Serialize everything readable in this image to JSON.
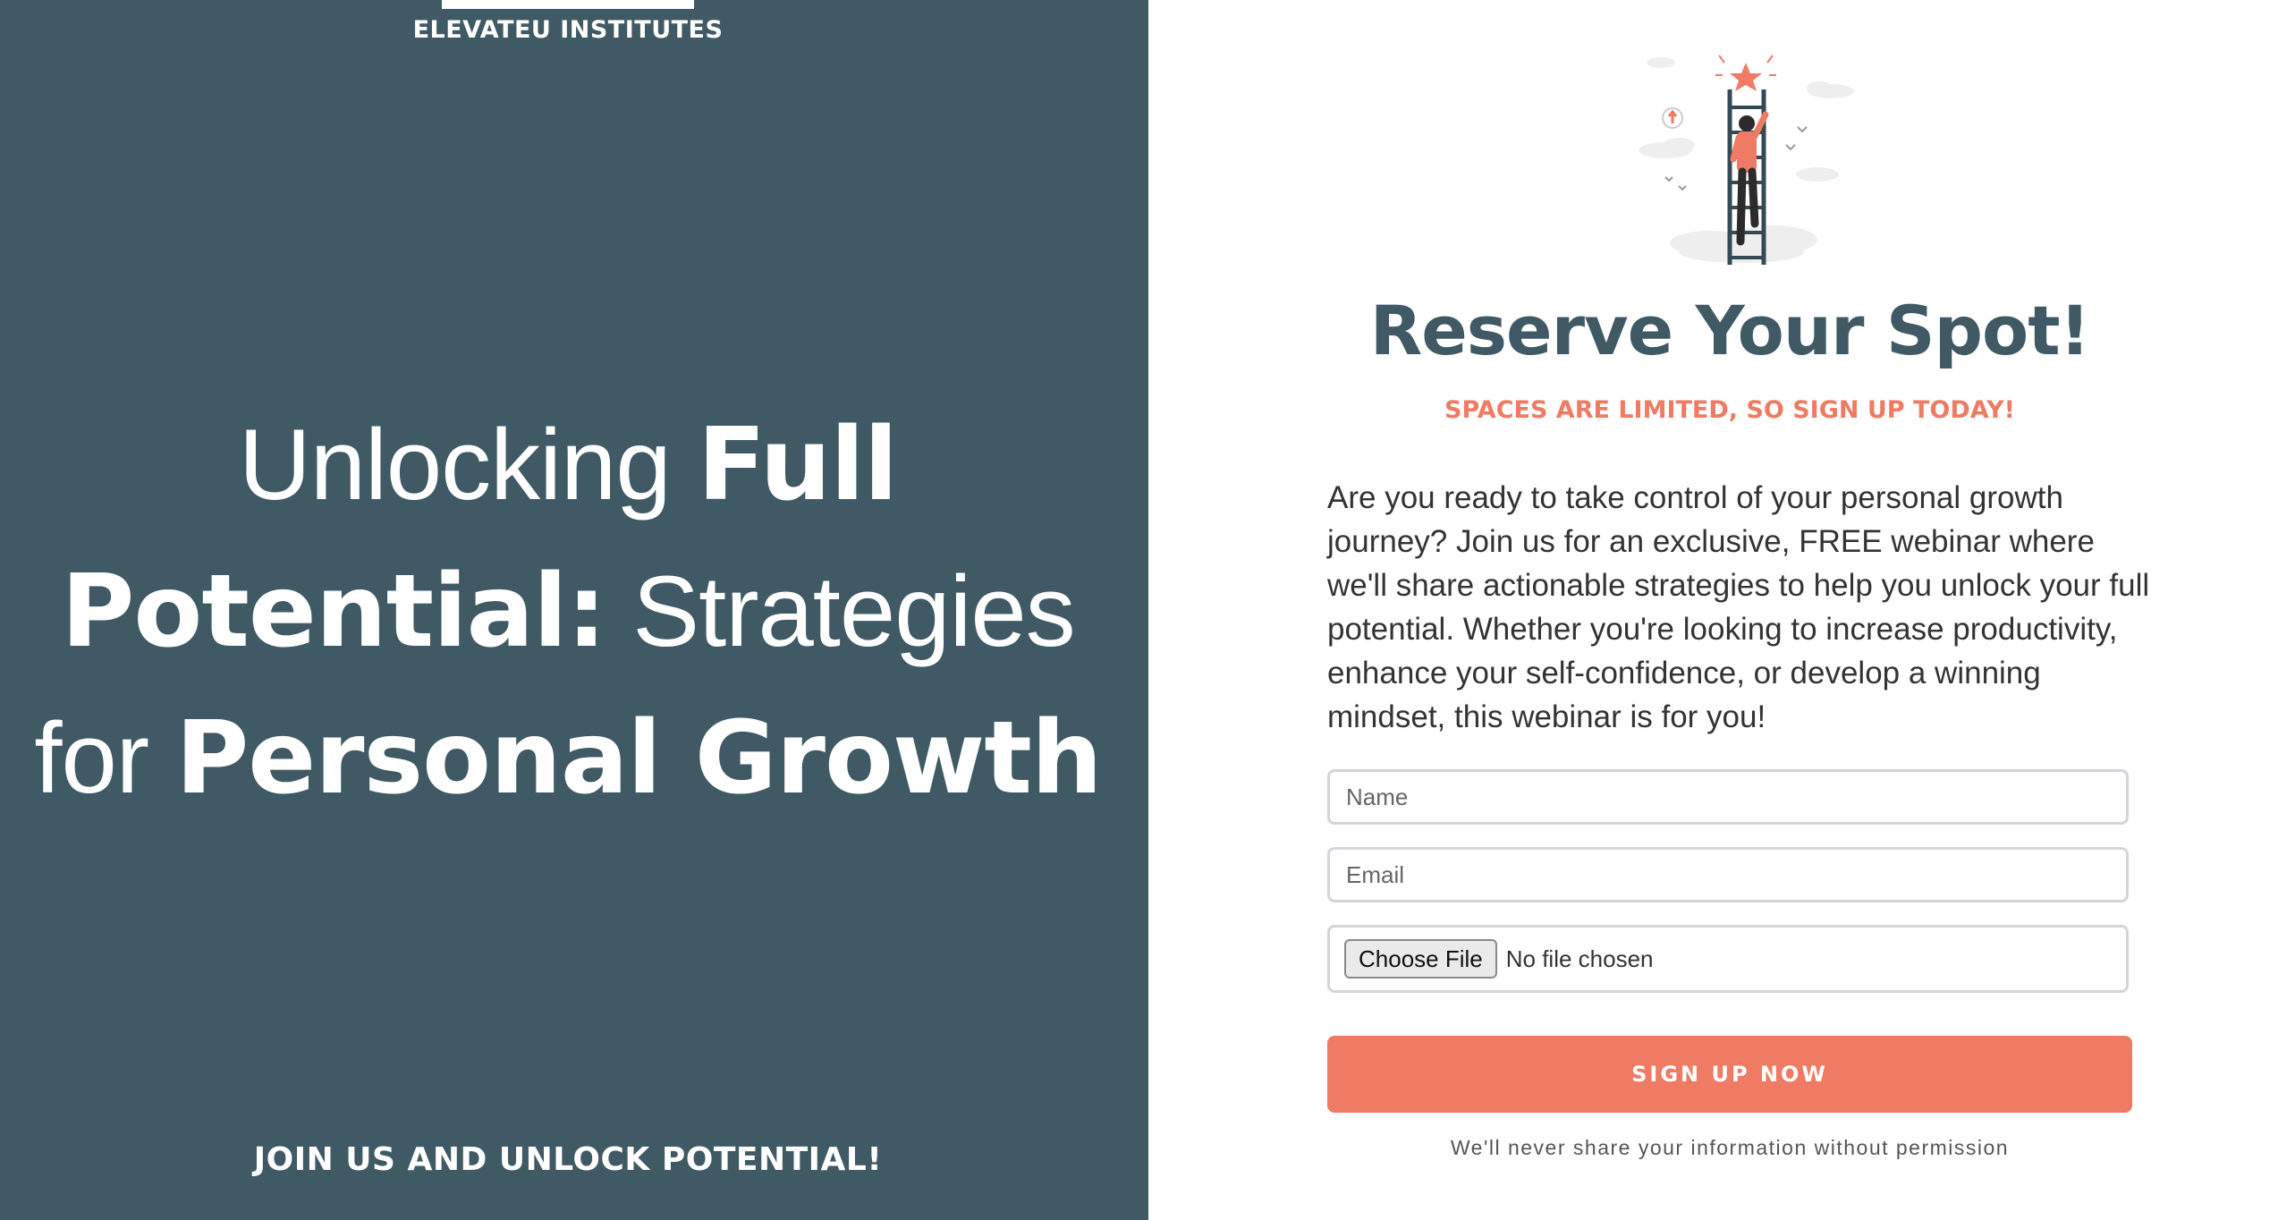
{
  "brand": {
    "name": "ELEVATEU INSTITUTES"
  },
  "hero": {
    "part1": "Unlocking ",
    "part2": "Full Potential:",
    "part3": " Strategies for ",
    "part4": "Personal Growth"
  },
  "left_footer": "JOIN US AND UNLOCK POTENTIAL!",
  "form": {
    "title": "Reserve Your Spot!",
    "subtitle": "SPACES ARE LIMITED, SO SIGN UP TODAY!",
    "description": "Are you ready to take control of your personal growth journey? Join us for an exclusive, FREE webinar where we'll share actionable strategies to help you unlock your full potential. Whether you're looking to increase productivity, enhance your self-confidence, or develop a winning mindset, this webinar is for you!",
    "name_placeholder": "Name",
    "email_placeholder": "Email",
    "file_button": "Choose File",
    "file_status": "No file chosen",
    "submit_label": "SIGN UP NOW",
    "privacy": "We'll never share your information without permission"
  },
  "colors": {
    "panel": "#3f5a65",
    "accent": "#ef7b64"
  },
  "icons": {
    "illustration": "ladder-climber-illustration"
  }
}
